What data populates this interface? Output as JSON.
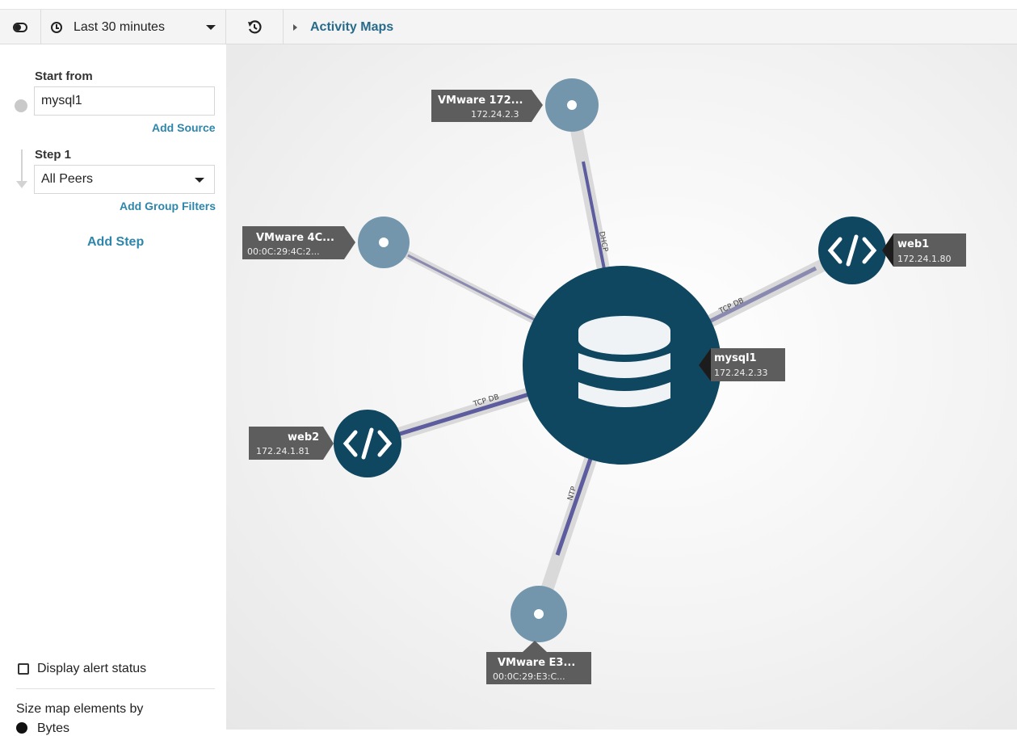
{
  "topbar": {
    "time_range": "Last 30 minutes",
    "breadcrumb": "Activity Maps"
  },
  "sidebar": {
    "start_from_label": "Start from",
    "source_value": "mysql1",
    "add_source": "Add Source",
    "step_label": "Step 1",
    "step_filter": "All Peers",
    "add_group_filters": "Add Group Filters",
    "add_step": "Add Step",
    "display_alert_status": "Display alert status",
    "size_by_label": "Size map elements by",
    "size_by_option": "Bytes"
  },
  "map": {
    "center": {
      "name": "mysql1",
      "ip": "172.24.2.33",
      "icon": "database-icon"
    },
    "peers": [
      {
        "id": "vmware-172",
        "name": "VMware 172...",
        "ip": "172.24.2.3",
        "protocol": "DHCP",
        "icon": "device-icon"
      },
      {
        "id": "vmware-4c",
        "name": "VMware 4C...",
        "ip": "00:0C:29:4C:2...",
        "protocol": "",
        "icon": "device-icon"
      },
      {
        "id": "web1",
        "name": "web1",
        "ip": "172.24.1.80",
        "protocol": "TCP DB",
        "icon": "code-icon"
      },
      {
        "id": "web2",
        "name": "web2",
        "ip": "172.24.1.81",
        "protocol": "TCP DB",
        "icon": "code-icon"
      },
      {
        "id": "vmware-e3",
        "name": "VMware E3...",
        "ip": "00:0C:29:E3:C...",
        "protocol": "NTP",
        "icon": "device-icon"
      }
    ]
  },
  "colors": {
    "accent_link": "#2e86ab",
    "breadcrumb_link": "#276a8a",
    "center_node": "#0f4660",
    "app_node": "#0f4660",
    "device_node": "#7396ad",
    "edge_protocol": "#5c5c9e",
    "label_bg": "#5d5d5d"
  }
}
